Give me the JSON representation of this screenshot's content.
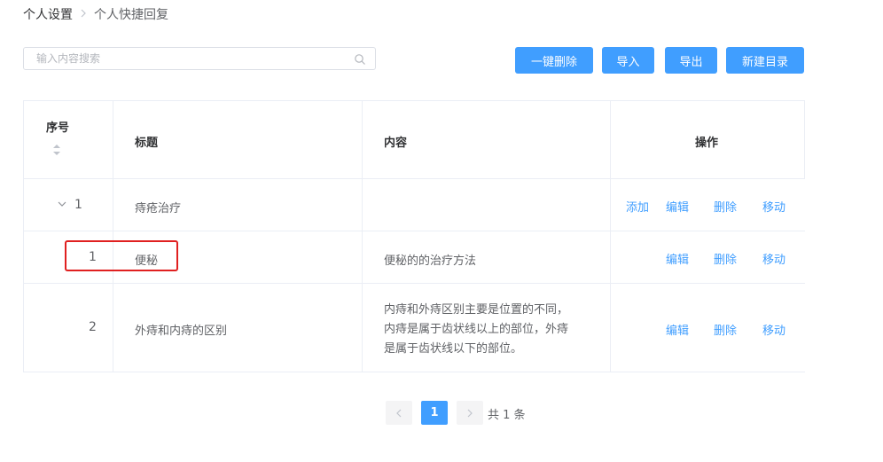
{
  "breadcrumb": {
    "parent": "个人设置",
    "current": "个人快捷回复"
  },
  "search": {
    "placeholder": "输入内容搜索"
  },
  "toolbar": {
    "bulk_delete": "一键删除",
    "import": "导入",
    "export": "导出",
    "new_folder": "新建目录"
  },
  "table": {
    "columns": {
      "index": "序号",
      "title": "标题",
      "content": "内容",
      "actions": "操作"
    },
    "actions": {
      "add": "添加",
      "edit": "编辑",
      "delete": "删除",
      "move": "移动"
    },
    "rows": [
      {
        "index": "1",
        "title": "痔疮治疗",
        "content": "",
        "expandable": true
      },
      {
        "index": "1",
        "title": "便秘",
        "content": "便秘的的治疗方法"
      },
      {
        "index": "2",
        "title": "外痔和内痔的区别",
        "content_lines": [
          "内痔和外痔区别主要是位置的不同，",
          "内痔是属于齿状线以上的部位，外痔",
          "是属于齿状线以下的部位。"
        ]
      }
    ]
  },
  "pagination": {
    "current_page": "1",
    "total": "共 1 条"
  },
  "colors": {
    "primary": "#409eff",
    "highlight": "#e02020"
  }
}
